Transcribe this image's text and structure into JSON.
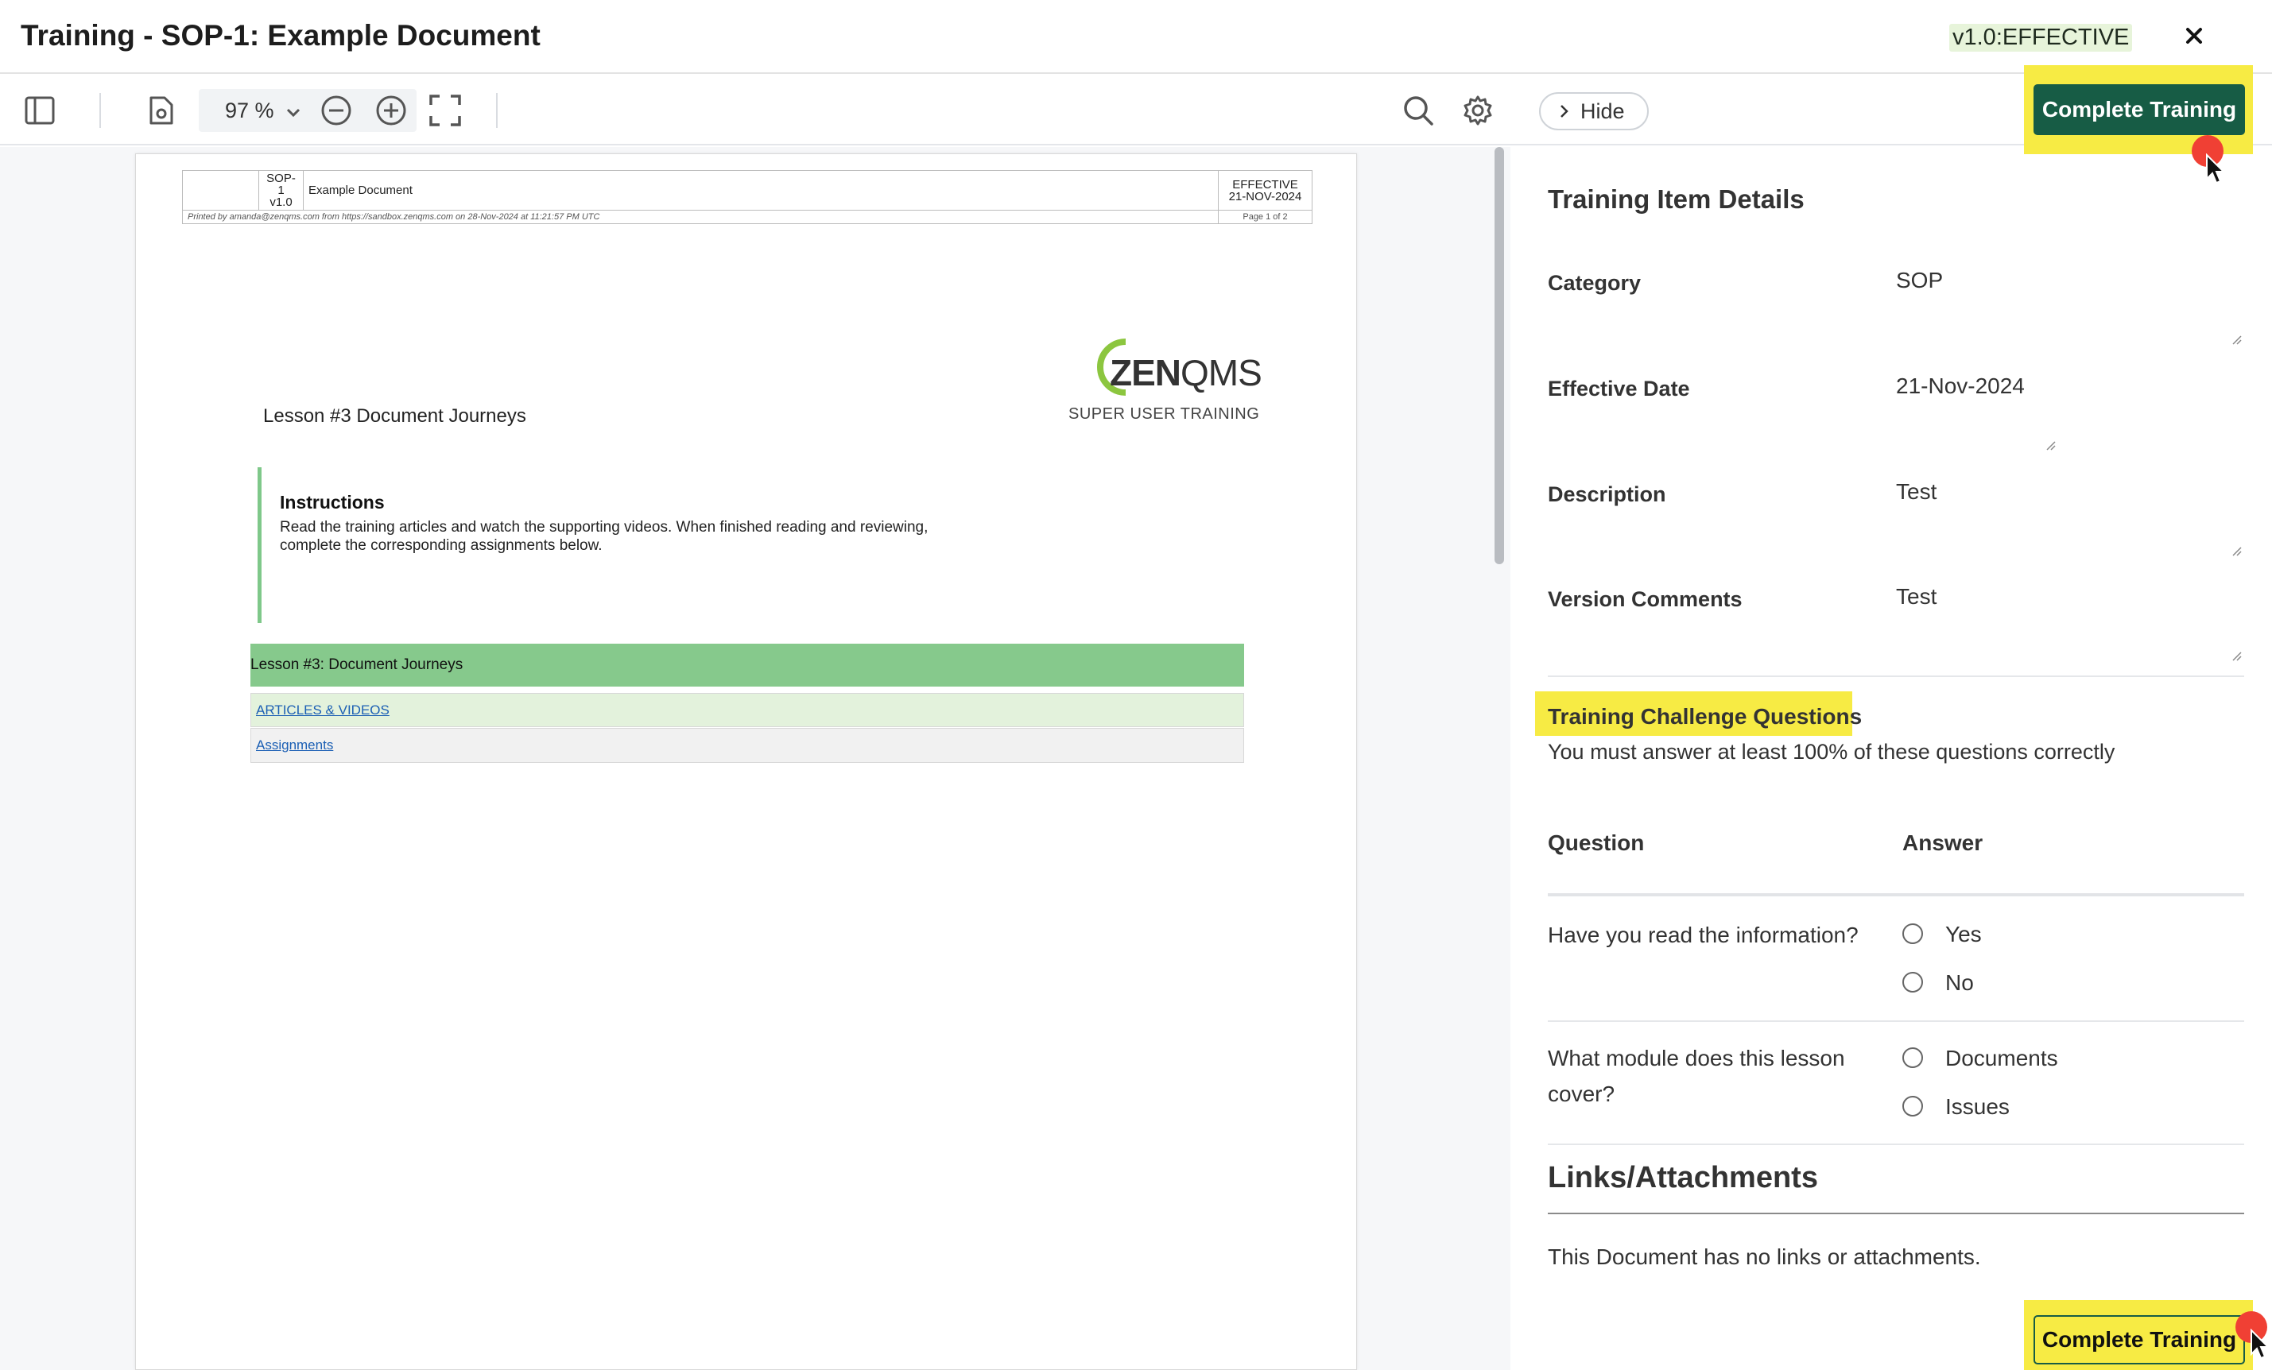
{
  "window": {
    "title": "Training - SOP-1: Example Document",
    "version_badge": "v1.0:EFFECTIVE"
  },
  "viewer_toolbar": {
    "zoom_value": "97 %"
  },
  "document": {
    "header": {
      "doc_id": "SOP-1",
      "doc_version": "v1.0",
      "doc_title": "Example Document",
      "status": "EFFECTIVE",
      "status_date": "21-NOV-2024",
      "printed_by": "Printed by amanda@zenqms.com from https://sandbox.zenqms.com on 28-Nov-2024 at 11:21:57 PM UTC",
      "page": "Page 1 of 2"
    },
    "logo_text_bold": "ZEN",
    "logo_text_light": "QMS",
    "logo_subtitle": "SUPER USER TRAINING",
    "lesson_title": "Lesson #3 Document Journeys",
    "instructions_heading": "Instructions",
    "instructions_body_line1": "Read the training articles and watch the supporting videos. When finished reading and reviewing,",
    "instructions_body_line2": "complete the corresponding assignments below.",
    "green_bar_title": "Lesson #3: Document Journeys",
    "link_articles": "ARTICLES & VIDEOS",
    "link_assignments": "Assignments"
  },
  "panel": {
    "hide_label": "Hide",
    "complete_button_label": "Complete Training",
    "section_title": "Training Item Details",
    "fields": [
      {
        "label": "Category",
        "value": "SOP"
      },
      {
        "label": "Effective Date",
        "value": "21-Nov-2024"
      },
      {
        "label": "Description",
        "value": "Test"
      },
      {
        "label": "Version Comments",
        "value": "Test"
      }
    ],
    "challenge": {
      "title": "Training Challenge Questions",
      "subtitle": "You must answer at least 100% of these questions correctly",
      "col_question": "Question",
      "col_answer": "Answer",
      "questions": [
        {
          "text": "Have you read the information?",
          "options": [
            "Yes",
            "No"
          ]
        },
        {
          "text": "What module does this lesson cover?",
          "options": [
            "Documents",
            "Issues"
          ]
        }
      ]
    },
    "links_title": "Links/Attachments",
    "links_text": "This Document has no links or attachments."
  },
  "colors": {
    "primary_button": "#175c45",
    "highlight": "#f7eb44",
    "green_bar": "#86c98c",
    "effective_badge_bg": "#e7f4da"
  },
  "icons": [
    "sidebar-toggle-icon",
    "document-settings-icon",
    "chevron-down-icon",
    "zoom-out-icon",
    "zoom-in-icon",
    "fullscreen-icon",
    "search-icon",
    "gear-icon",
    "close-icon",
    "chevron-right-icon"
  ]
}
